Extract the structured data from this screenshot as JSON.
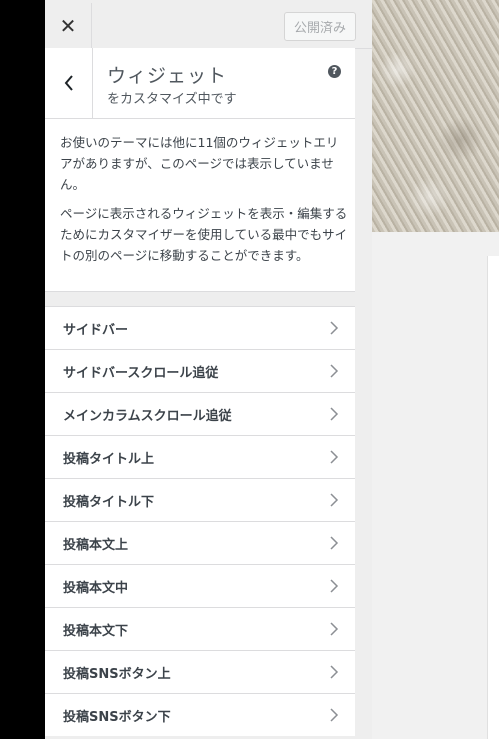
{
  "topbar": {
    "close_label": "✕",
    "publish_label": "公開済み"
  },
  "section": {
    "title": "ウィジェット",
    "subtitle": "をカスタマイズ中です",
    "help": "?"
  },
  "description": {
    "p1": "お使いのテーマには他に11個のウィジェットエリアがありますが、このページでは表示していません。",
    "p2": "ページに表示されるウィジェットを表示・編集するためにカスタマイザーを使用している最中でもサイトの別のページに移動することができます。"
  },
  "widget_areas": [
    "サイドバー",
    "サイドバースクロール追従",
    "メインカラムスクロール追従",
    "投稿タイトル上",
    "投稿タイトル下",
    "投稿本文上",
    "投稿本文中",
    "投稿本文下",
    "投稿SNSボタン上",
    "投稿SNSボタン下"
  ],
  "icons": {
    "close": "close-icon",
    "back": "chevron-left-icon",
    "help": "help-icon",
    "item": "chevron-right-icon"
  }
}
